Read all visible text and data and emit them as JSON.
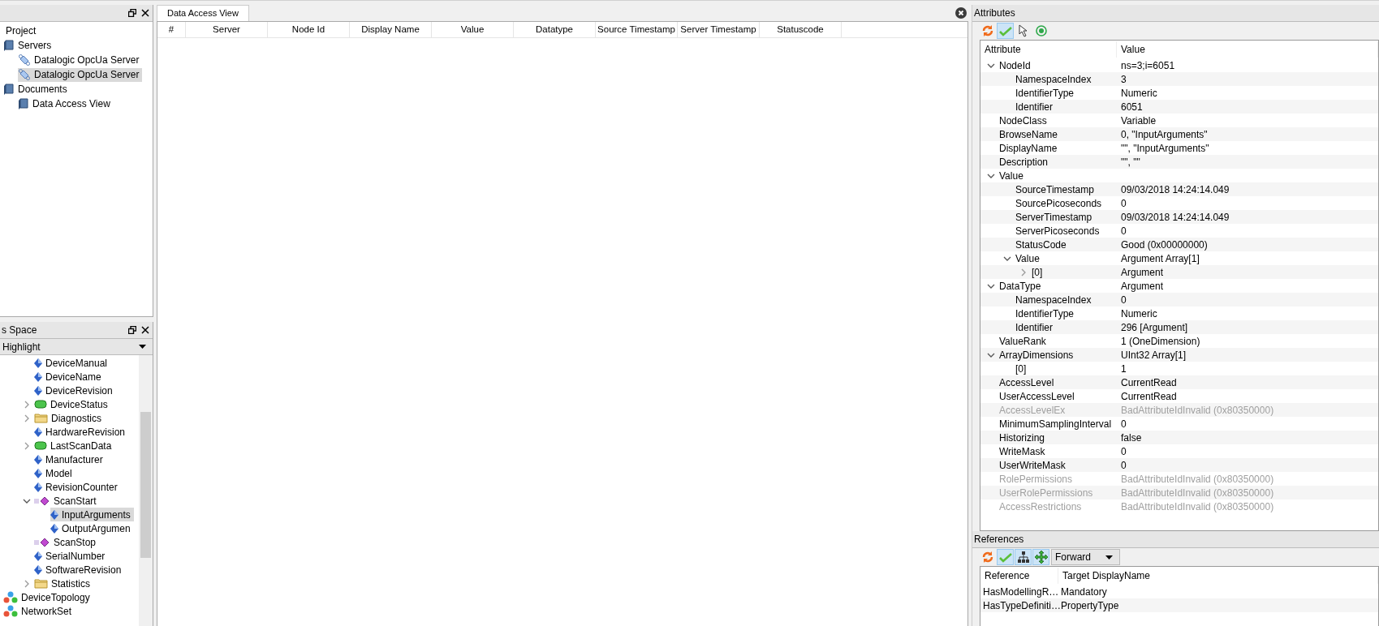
{
  "project_panel": {
    "title": "Project",
    "items": [
      {
        "label": "Servers",
        "kind": "book",
        "selected": false,
        "children": [
          {
            "label": "Datalogic OpcUa Server",
            "kind": "server",
            "selected": false
          },
          {
            "label": "Datalogic OpcUa Server",
            "kind": "server",
            "selected": true
          }
        ]
      },
      {
        "label": "Documents",
        "kind": "book",
        "selected": false,
        "children": [
          {
            "label": "Data Access View",
            "kind": "book",
            "selected": false
          }
        ]
      }
    ]
  },
  "address_space": {
    "title": "s Space",
    "filter": "Highlight",
    "tree": {
      "scrolled_items": [
        {
          "label": "DeviceManual",
          "kind": "variable",
          "selected": false
        },
        {
          "label": "DeviceName",
          "kind": "variable",
          "selected": false
        },
        {
          "label": "DeviceRevision",
          "kind": "variable",
          "selected": false
        },
        {
          "label": "DeviceStatus",
          "kind": "object",
          "selected": false,
          "expanded": false
        },
        {
          "label": "Diagnostics",
          "kind": "folder",
          "selected": false,
          "expanded": false
        },
        {
          "label": "HardwareRevision",
          "kind": "variable",
          "selected": false
        },
        {
          "label": "LastScanData",
          "kind": "object",
          "selected": false,
          "expanded": false
        },
        {
          "label": "Manufacturer",
          "kind": "variable",
          "selected": false
        },
        {
          "label": "Model",
          "kind": "variable",
          "selected": false
        },
        {
          "label": "RevisionCounter",
          "kind": "variable",
          "selected": false
        },
        {
          "label": "ScanStart",
          "kind": "method",
          "selected": false,
          "expanded": true,
          "children": [
            {
              "label": "InputArguments",
              "kind": "variable",
              "selected": true
            },
            {
              "label": "OutputArgumen",
              "kind": "variable",
              "selected": false
            }
          ]
        },
        {
          "label": "ScanStop",
          "kind": "method",
          "selected": false
        },
        {
          "label": "SerialNumber",
          "kind": "variable",
          "selected": false
        },
        {
          "label": "SoftwareRevision",
          "kind": "variable",
          "selected": false
        },
        {
          "label": "Statistics",
          "kind": "folder",
          "selected": false,
          "expanded": false
        }
      ],
      "root_items": [
        {
          "label": "DeviceTopology",
          "kind": "topology",
          "selected": false
        },
        {
          "label": "NetworkSet",
          "kind": "topology",
          "selected": false
        }
      ]
    }
  },
  "document": {
    "tab": {
      "label": "Data Access View",
      "selected": true
    },
    "columns": [
      "#",
      "Server",
      "Node Id",
      "Display Name",
      "Value",
      "Datatype",
      "Source Timestamp",
      "Server Timestamp",
      "Statuscode"
    ]
  },
  "attributes": {
    "title": "Attributes",
    "toolbar": [
      {
        "kind": "refresh",
        "on": false
      },
      {
        "kind": "check",
        "on": true
      },
      {
        "kind": "cursor",
        "on": false
      },
      {
        "kind": "target",
        "on": false
      }
    ],
    "columns": [
      "Attribute",
      "Value"
    ],
    "rows": [
      {
        "name": "NodeId",
        "value": "ns=3;i=6051",
        "disabled": false,
        "expanded": true,
        "children": [
          {
            "name": "NamespaceIndex",
            "value": "3",
            "disabled": false
          },
          {
            "name": "IdentifierType",
            "value": "Numeric",
            "disabled": false
          },
          {
            "name": "Identifier",
            "value": "6051",
            "disabled": false
          }
        ]
      },
      {
        "name": "NodeClass",
        "value": "Variable",
        "disabled": false
      },
      {
        "name": "BrowseName",
        "value": "0, \"InputArguments\"",
        "disabled": false
      },
      {
        "name": "DisplayName",
        "value": "\"\", \"InputArguments\"",
        "disabled": false
      },
      {
        "name": "Description",
        "value": "\"\", \"\"",
        "disabled": false
      },
      {
        "name": "Value",
        "disabled": false,
        "expanded": true,
        "children": [
          {
            "name": "SourceTimestamp",
            "value": "09/03/2018 14:24:14.049",
            "disabled": false
          },
          {
            "name": "SourcePicoseconds",
            "value": "0",
            "disabled": false
          },
          {
            "name": "ServerTimestamp",
            "value": "09/03/2018 14:24:14.049",
            "disabled": false
          },
          {
            "name": "ServerPicoseconds",
            "value": "0",
            "disabled": false
          },
          {
            "name": "StatusCode",
            "value": "Good (0x00000000)",
            "disabled": false
          },
          {
            "name": "Value",
            "value": "Argument Array[1]",
            "disabled": false,
            "expanded": true,
            "children": [
              {
                "name": "[0]",
                "value": "Argument",
                "disabled": false,
                "expanded": false
              }
            ]
          }
        ]
      },
      {
        "name": "DataType",
        "value": "Argument",
        "disabled": false,
        "expanded": true,
        "children": [
          {
            "name": "NamespaceIndex",
            "value": "0",
            "disabled": false
          },
          {
            "name": "IdentifierType",
            "value": "Numeric",
            "disabled": false
          },
          {
            "name": "Identifier",
            "value": "296 [Argument]",
            "disabled": false
          }
        ]
      },
      {
        "name": "ValueRank",
        "value": "1 (OneDimension)",
        "disabled": false
      },
      {
        "name": "ArrayDimensions",
        "value": "UInt32 Array[1]",
        "disabled": false,
        "expanded": true,
        "children": [
          {
            "name": "[0]",
            "value": "1",
            "disabled": false
          }
        ]
      },
      {
        "name": "AccessLevel",
        "value": "CurrentRead",
        "disabled": false
      },
      {
        "name": "UserAccessLevel",
        "value": "CurrentRead",
        "disabled": false
      },
      {
        "name": "AccessLevelEx",
        "value": "BadAttributeIdInvalid (0x80350000)",
        "disabled": true
      },
      {
        "name": "MinimumSamplingInterval",
        "value": "0",
        "disabled": false
      },
      {
        "name": "Historizing",
        "value": "false",
        "disabled": false
      },
      {
        "name": "WriteMask",
        "value": "0",
        "disabled": false
      },
      {
        "name": "UserWriteMask",
        "value": "0",
        "disabled": false
      },
      {
        "name": "RolePermissions",
        "value": "BadAttributeIdInvalid (0x80350000)",
        "disabled": true
      },
      {
        "name": "UserRolePermissions",
        "value": "BadAttributeIdInvalid (0x80350000)",
        "disabled": true
      },
      {
        "name": "AccessRestrictions",
        "value": "BadAttributeIdInvalid (0x80350000)",
        "disabled": true
      }
    ]
  },
  "references": {
    "title": "References",
    "toolbar": [
      {
        "kind": "refresh",
        "on": false
      },
      {
        "kind": "check",
        "on": true
      },
      {
        "kind": "hierarchy",
        "on": true
      },
      {
        "kind": "move",
        "on": true
      }
    ],
    "direction": "Forward",
    "columns": [
      "Reference",
      "Target DisplayName"
    ],
    "rows": [
      [
        "HasModellingR…",
        "Mandatory"
      ],
      [
        "HasTypeDefiniti…",
        "PropertyType"
      ]
    ]
  }
}
